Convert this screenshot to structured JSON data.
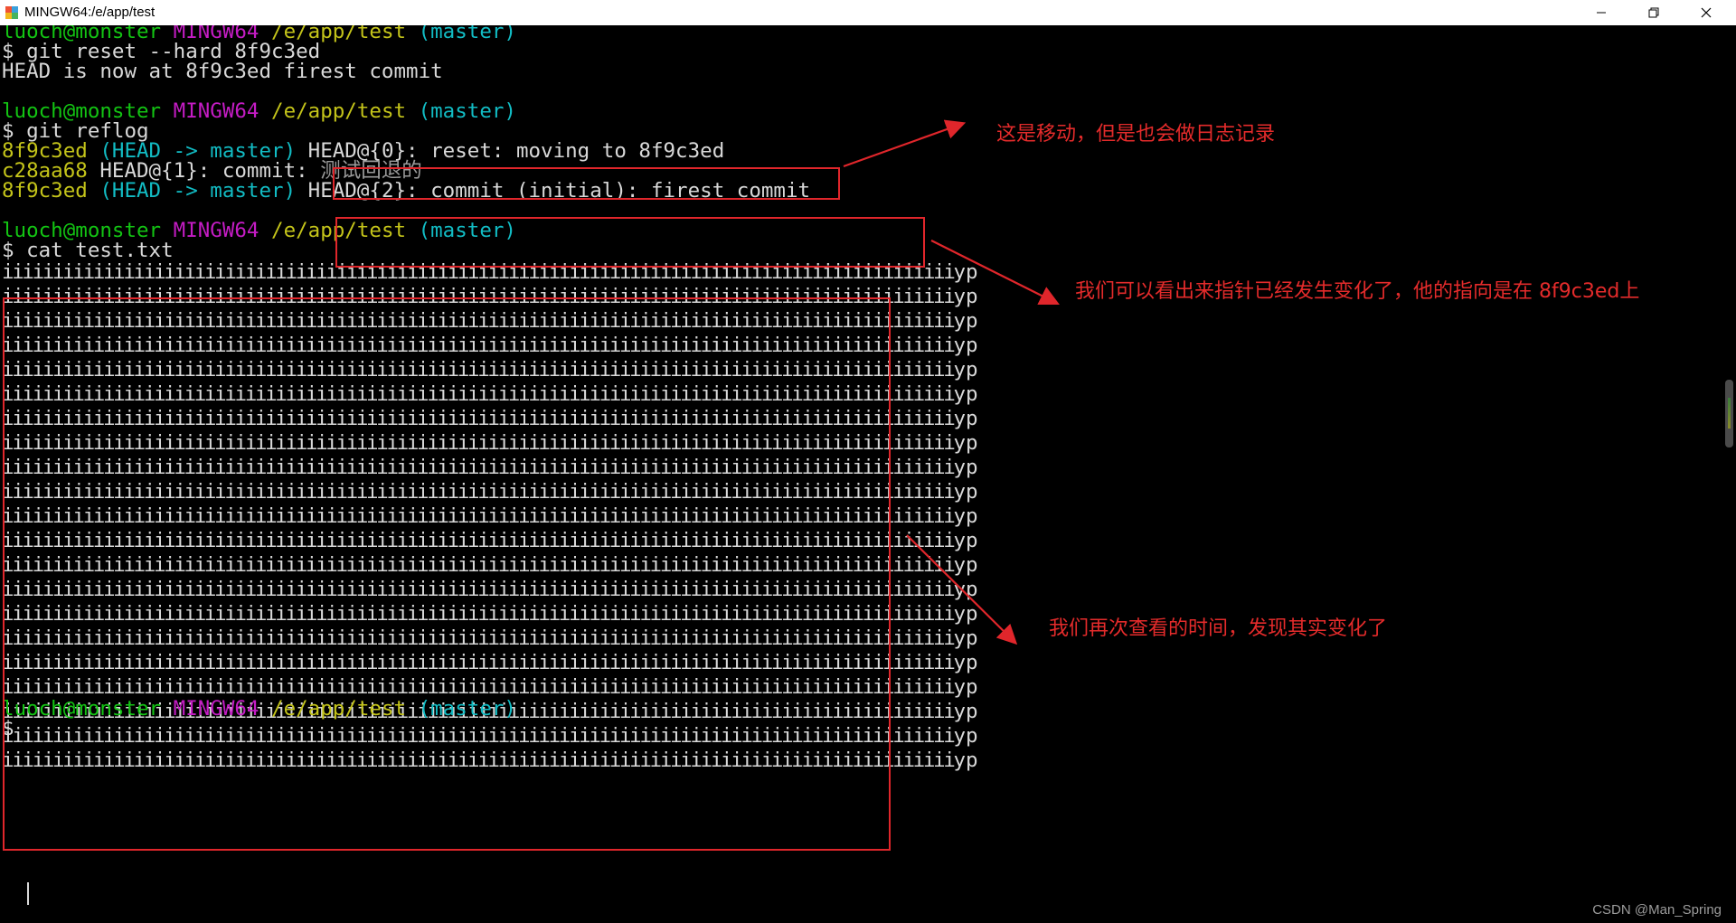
{
  "window": {
    "title": "MINGW64:/e/app/test",
    "icon": "git-bash-icon",
    "controls": [
      "minimize-icon",
      "maximize-icon",
      "close-icon"
    ]
  },
  "prompt": {
    "user": "luoch@monster",
    "system": "MINGW64",
    "path": "/e/app/test",
    "branch": "(master)",
    "symbol": "$"
  },
  "session": {
    "cmd_reset": "git reset --hard 8f9c3ed",
    "reset_output": "HEAD is now at 8f9c3ed firest commit",
    "cmd_reflog": "git reflog",
    "reflog": [
      {
        "hash": "8f9c3ed",
        "refs": "(HEAD -> master)",
        "entry": "HEAD@{0}: reset: moving to 8f9c3ed"
      },
      {
        "hash": "c28aa68",
        "refs": "",
        "entry": "HEAD@{1}: commit: ",
        "message": "测试回退的"
      },
      {
        "hash": "8f9c3ed",
        "refs": "(HEAD -> master)",
        "entry": "HEAD@{2}: commit (initial): firest commit"
      }
    ],
    "cmd_cat": "cat test.txt",
    "file_line_body": "iiiiiiiiiiiiiiiiiiiiiiiiiiiiiiiiiiiiiiiiiiiiiiiiiiiiiiiiiiiiiiiiiiiiiiiiiiiiiiiiiiiiiiiiiiiiii",
    "file_line_end": "yp",
    "file_line_count": 21
  },
  "annotations": {
    "a1": "这是移动，但是也会做日志记录",
    "a2": "我们可以看出来指针已经发生变化了，他的指向是在 8f9c3ed上",
    "a3": "我们再次查看的时间，发现其实变化了"
  },
  "watermark": "CSDN @Man_Spring",
  "colors": {
    "terminal_bg": "#000000",
    "user_host": "#13c413",
    "mingw": "#c41cc4",
    "path": "#c4c41a",
    "branch": "#12bcc4",
    "annotation": "#e42b2b"
  }
}
